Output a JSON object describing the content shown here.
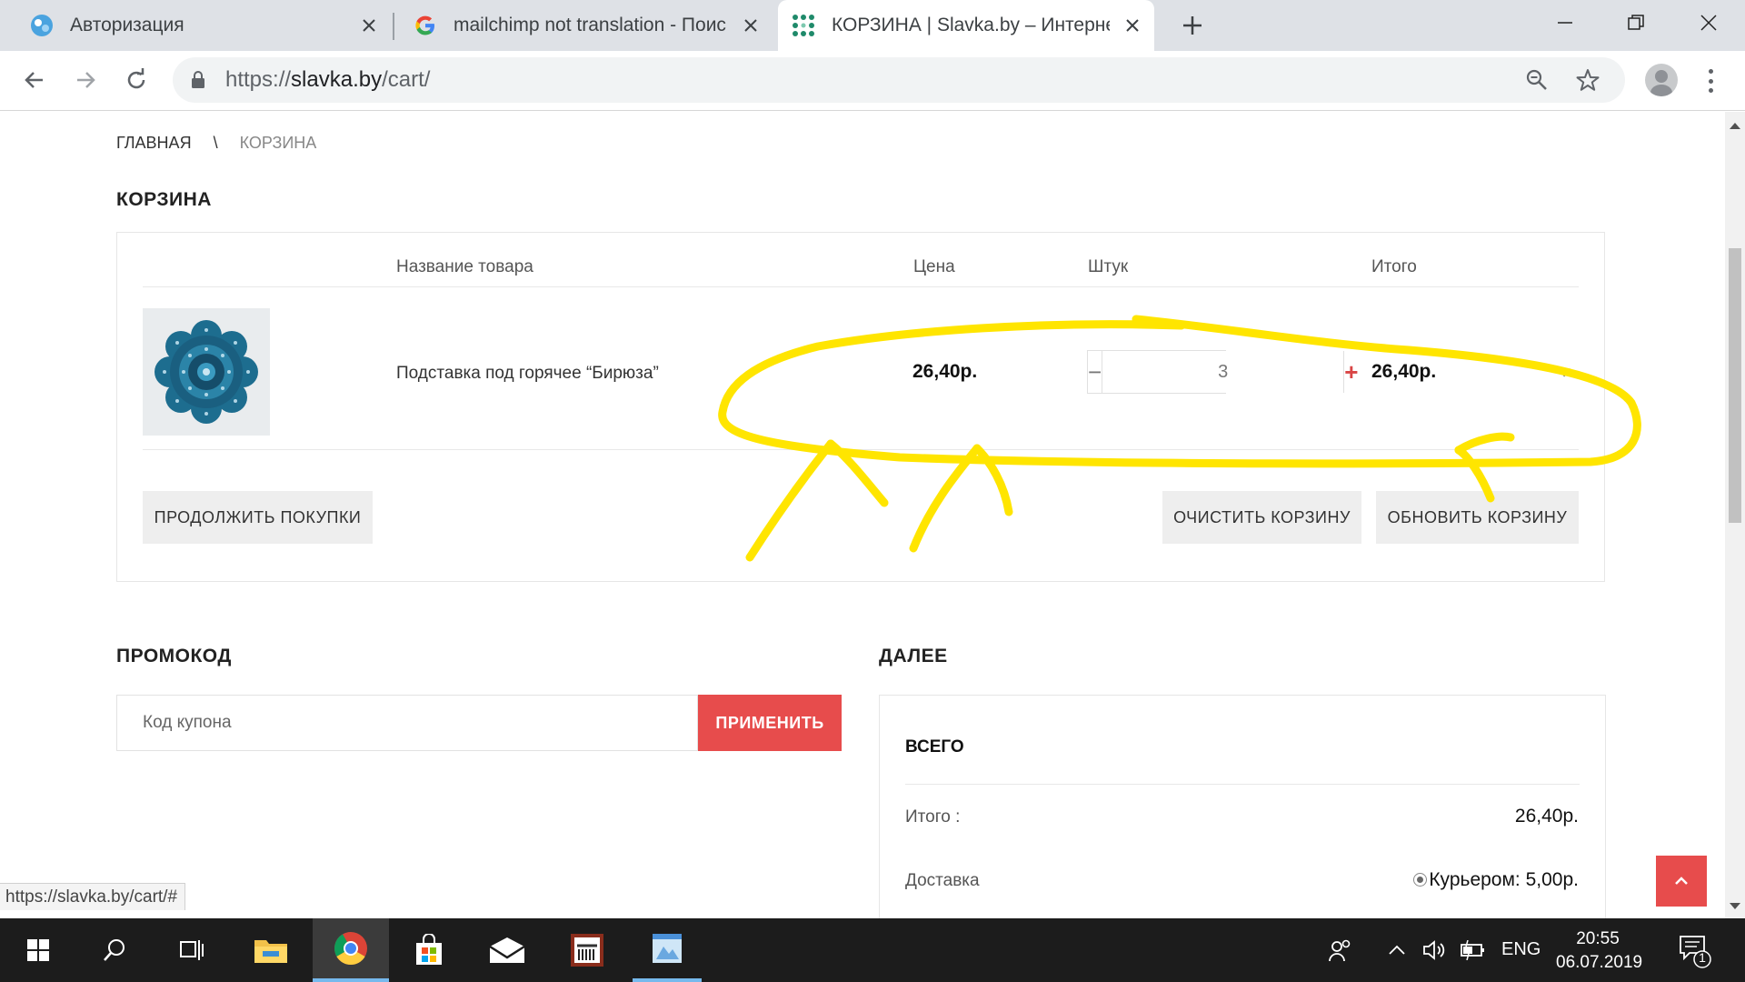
{
  "browser": {
    "tabs": [
      {
        "title": "Авторизация",
        "active": false
      },
      {
        "title": "mailchimp not translation - Поис",
        "active": false
      },
      {
        "title": "КОРЗИНА | Slavka.by – Интернет",
        "active": true
      }
    ],
    "url": {
      "scheme": "https://",
      "host": "slavka.by",
      "path": "/cart/"
    }
  },
  "page": {
    "breadcrumb": {
      "home": "ГЛАВНАЯ",
      "separator": "\\",
      "current": "КОРЗИНА"
    },
    "cart_title": "КОРЗИНА",
    "table": {
      "headers": {
        "name": "Название товара",
        "price": "Цена",
        "qty": "Штук",
        "total": "Итого"
      },
      "row": {
        "name": "Подставка под горячее “Бирюза”",
        "price": "26,40р.",
        "qty": "3",
        "total": "26,40р.",
        "remove": "×",
        "minus": "−",
        "plus": "+"
      }
    },
    "buttons": {
      "continue": "ПРОДОЛЖИТЬ ПОКУПКИ",
      "clear": "ОЧИСТИТЬ КОРЗИНУ",
      "update": "ОБНОВИТЬ КОРЗИНУ"
    },
    "promo": {
      "title": "ПРОМОКОД",
      "placeholder": "Код купона",
      "value": "",
      "apply": "ПРИМЕНИТЬ"
    },
    "next": {
      "title": "ДАЛЕЕ",
      "total_title": "ВСЕГО",
      "subtotal_label": "Итого :",
      "subtotal_value": "26,40р.",
      "delivery_label": "Доставка",
      "delivery_option_name": "Курьером:",
      "delivery_option_price": "5,00р."
    },
    "status_link": "https://slavka.by/cart/#"
  },
  "colors": {
    "accent_red": "#e74c4c",
    "annotation_yellow": "#ffe500"
  },
  "taskbar": {
    "apps": [
      "start-icon",
      "search-icon",
      "task-view-icon",
      "file-explorer-icon",
      "chrome-icon",
      "store-icon",
      "mail-icon",
      "font-app-icon",
      "image-app-icon"
    ],
    "lang": "ENG",
    "time": "20:55",
    "date": "06.07.2019",
    "notifications": "1"
  }
}
